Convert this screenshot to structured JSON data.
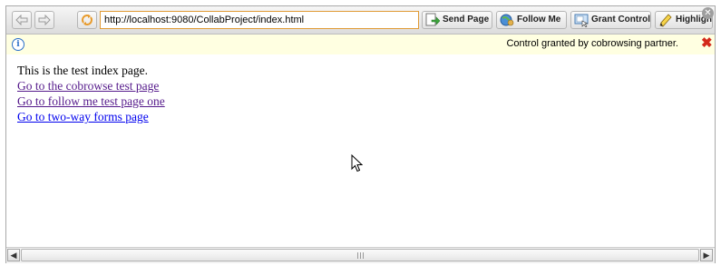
{
  "toolbar": {
    "back_icon": "back-arrow-icon",
    "forward_icon": "forward-arrow-icon",
    "refresh_icon": "refresh-icon",
    "url": "http://localhost:9080/CollabProject/index.html",
    "send_page_label": "Send Page",
    "follow_me_label": "Follow Me",
    "grant_control_label": "Grant Control",
    "highlight_label": "Highlight",
    "close_icon": "close-circle-icon"
  },
  "infobar": {
    "message": "Control granted by cobrowsing partner.",
    "info_icon": "info-icon",
    "close_icon": "red-x-icon",
    "background": "#ffffe1"
  },
  "page": {
    "intro": "This is the test index page.",
    "links": [
      {
        "label": "Go to the cobrowse test page",
        "visited": true
      },
      {
        "label": "Go to follow me test page one",
        "visited": true
      },
      {
        "label": "Go to two-way forms page",
        "visited": false
      }
    ]
  },
  "colors": {
    "link_visited": "#551a8b",
    "link_unvisited": "#0000ee",
    "url_border": "#e09a35"
  }
}
